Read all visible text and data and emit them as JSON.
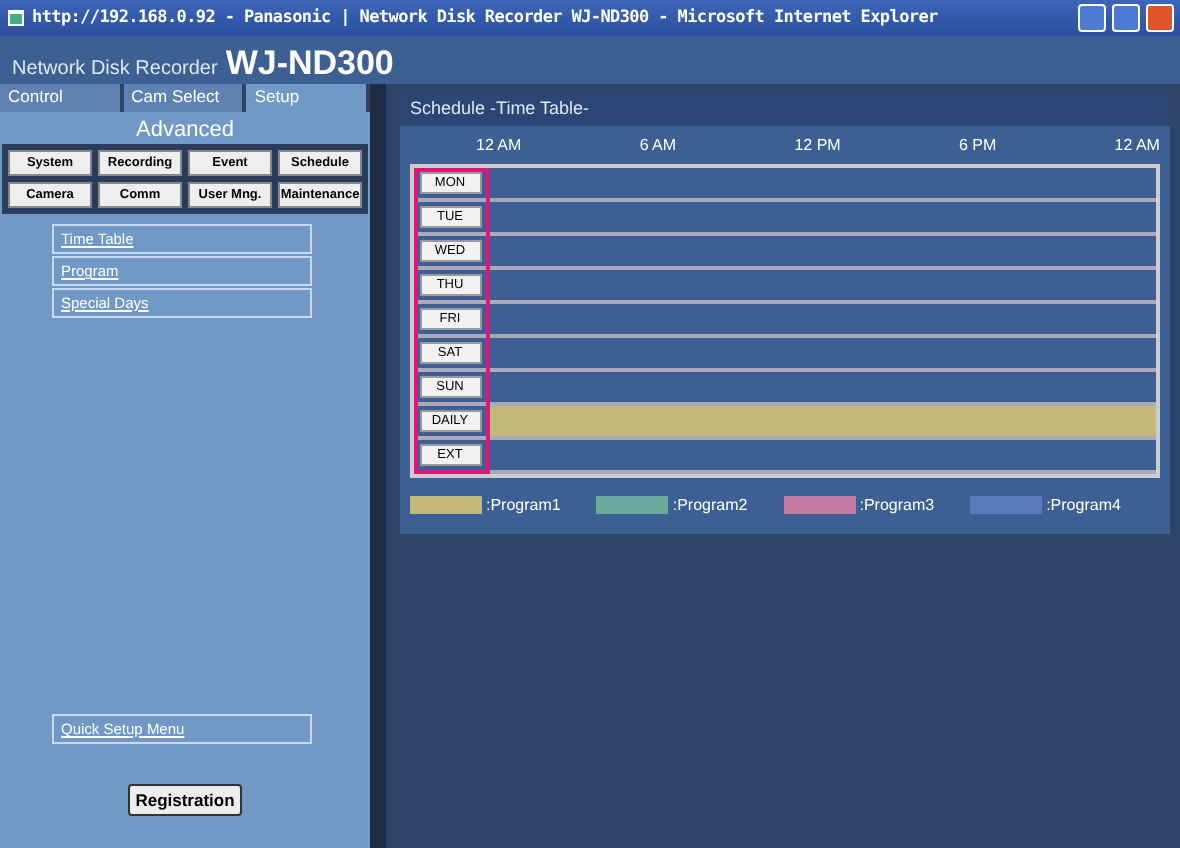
{
  "window": {
    "title": "http://192.168.0.92 - Panasonic | Network Disk Recorder WJ-ND300 - Microsoft Internet Explorer"
  },
  "header": {
    "subtitle": "Network Disk Recorder",
    "model": "WJ-ND300"
  },
  "tabs": [
    {
      "label": "Control",
      "selected": false
    },
    {
      "label": "Cam Select",
      "selected": false
    },
    {
      "label": "Setup",
      "selected": true
    }
  ],
  "sidebar": {
    "heading": "Advanced",
    "buttons": [
      "System",
      "Recording",
      "Event",
      "Schedule",
      "Camera",
      "Comm",
      "User Mng.",
      "Maintenance"
    ],
    "links": [
      "Time Table",
      "Program",
      "Special Days"
    ],
    "quick_link": "Quick Setup Menu",
    "register_button": "Registration"
  },
  "schedule": {
    "title": "Schedule  -Time Table-",
    "time_labels": [
      "12 AM",
      "6 AM",
      "12 PM",
      "6 PM",
      "12 AM"
    ],
    "rows": [
      {
        "day": "MON"
      },
      {
        "day": "TUE"
      },
      {
        "day": "WED"
      },
      {
        "day": "THU"
      },
      {
        "day": "FRI"
      },
      {
        "day": "SAT"
      },
      {
        "day": "SUN"
      },
      {
        "day": "DAILY",
        "color": "#c2b97a"
      },
      {
        "day": "EXT"
      }
    ],
    "legend": [
      {
        "label": ":Program1",
        "color": "#c2b97a"
      },
      {
        "label": ":Program2",
        "color": "#6aa89c"
      },
      {
        "label": ":Program3",
        "color": "#c47aa4"
      },
      {
        "label": ":Program4",
        "color": "#5a7ab8"
      }
    ]
  }
}
